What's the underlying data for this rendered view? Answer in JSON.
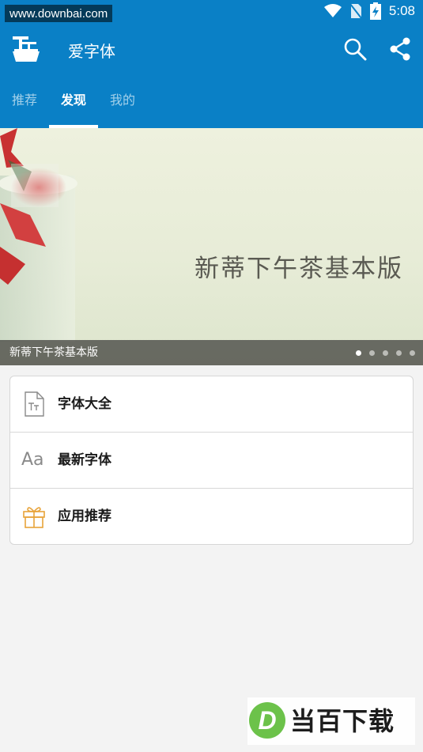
{
  "status_bar": {
    "watermark_url": "www.downbai.com",
    "time": "5:08",
    "icons": [
      "wifi-icon",
      "no-sim-icon",
      "battery-charging-icon"
    ]
  },
  "app_bar": {
    "title": "爱字体",
    "icons": [
      "app-logo-icon",
      "search-icon",
      "share-icon"
    ]
  },
  "tabs": [
    {
      "label": "推荐",
      "active": false
    },
    {
      "label": "发现",
      "active": true
    },
    {
      "label": "我的",
      "active": false
    }
  ],
  "banner": {
    "title": "新蒂下午茶基本版",
    "caption": "新蒂下午茶基本版",
    "dots_total": 5,
    "dots_active": 1
  },
  "menu": [
    {
      "label": "字体大全",
      "icon": "font-file-icon"
    },
    {
      "label": "最新字体",
      "icon": "aa-icon",
      "icon_text": "Aa"
    },
    {
      "label": "应用推荐",
      "icon": "gift-icon"
    }
  ],
  "watermark_logo": {
    "letter": "D",
    "text": "当百下载"
  },
  "colors": {
    "primary": "#0a80c6",
    "background": "#f3f3f3",
    "gift_icon": "#e8a33a",
    "watermark_green": "#6cc24a"
  }
}
